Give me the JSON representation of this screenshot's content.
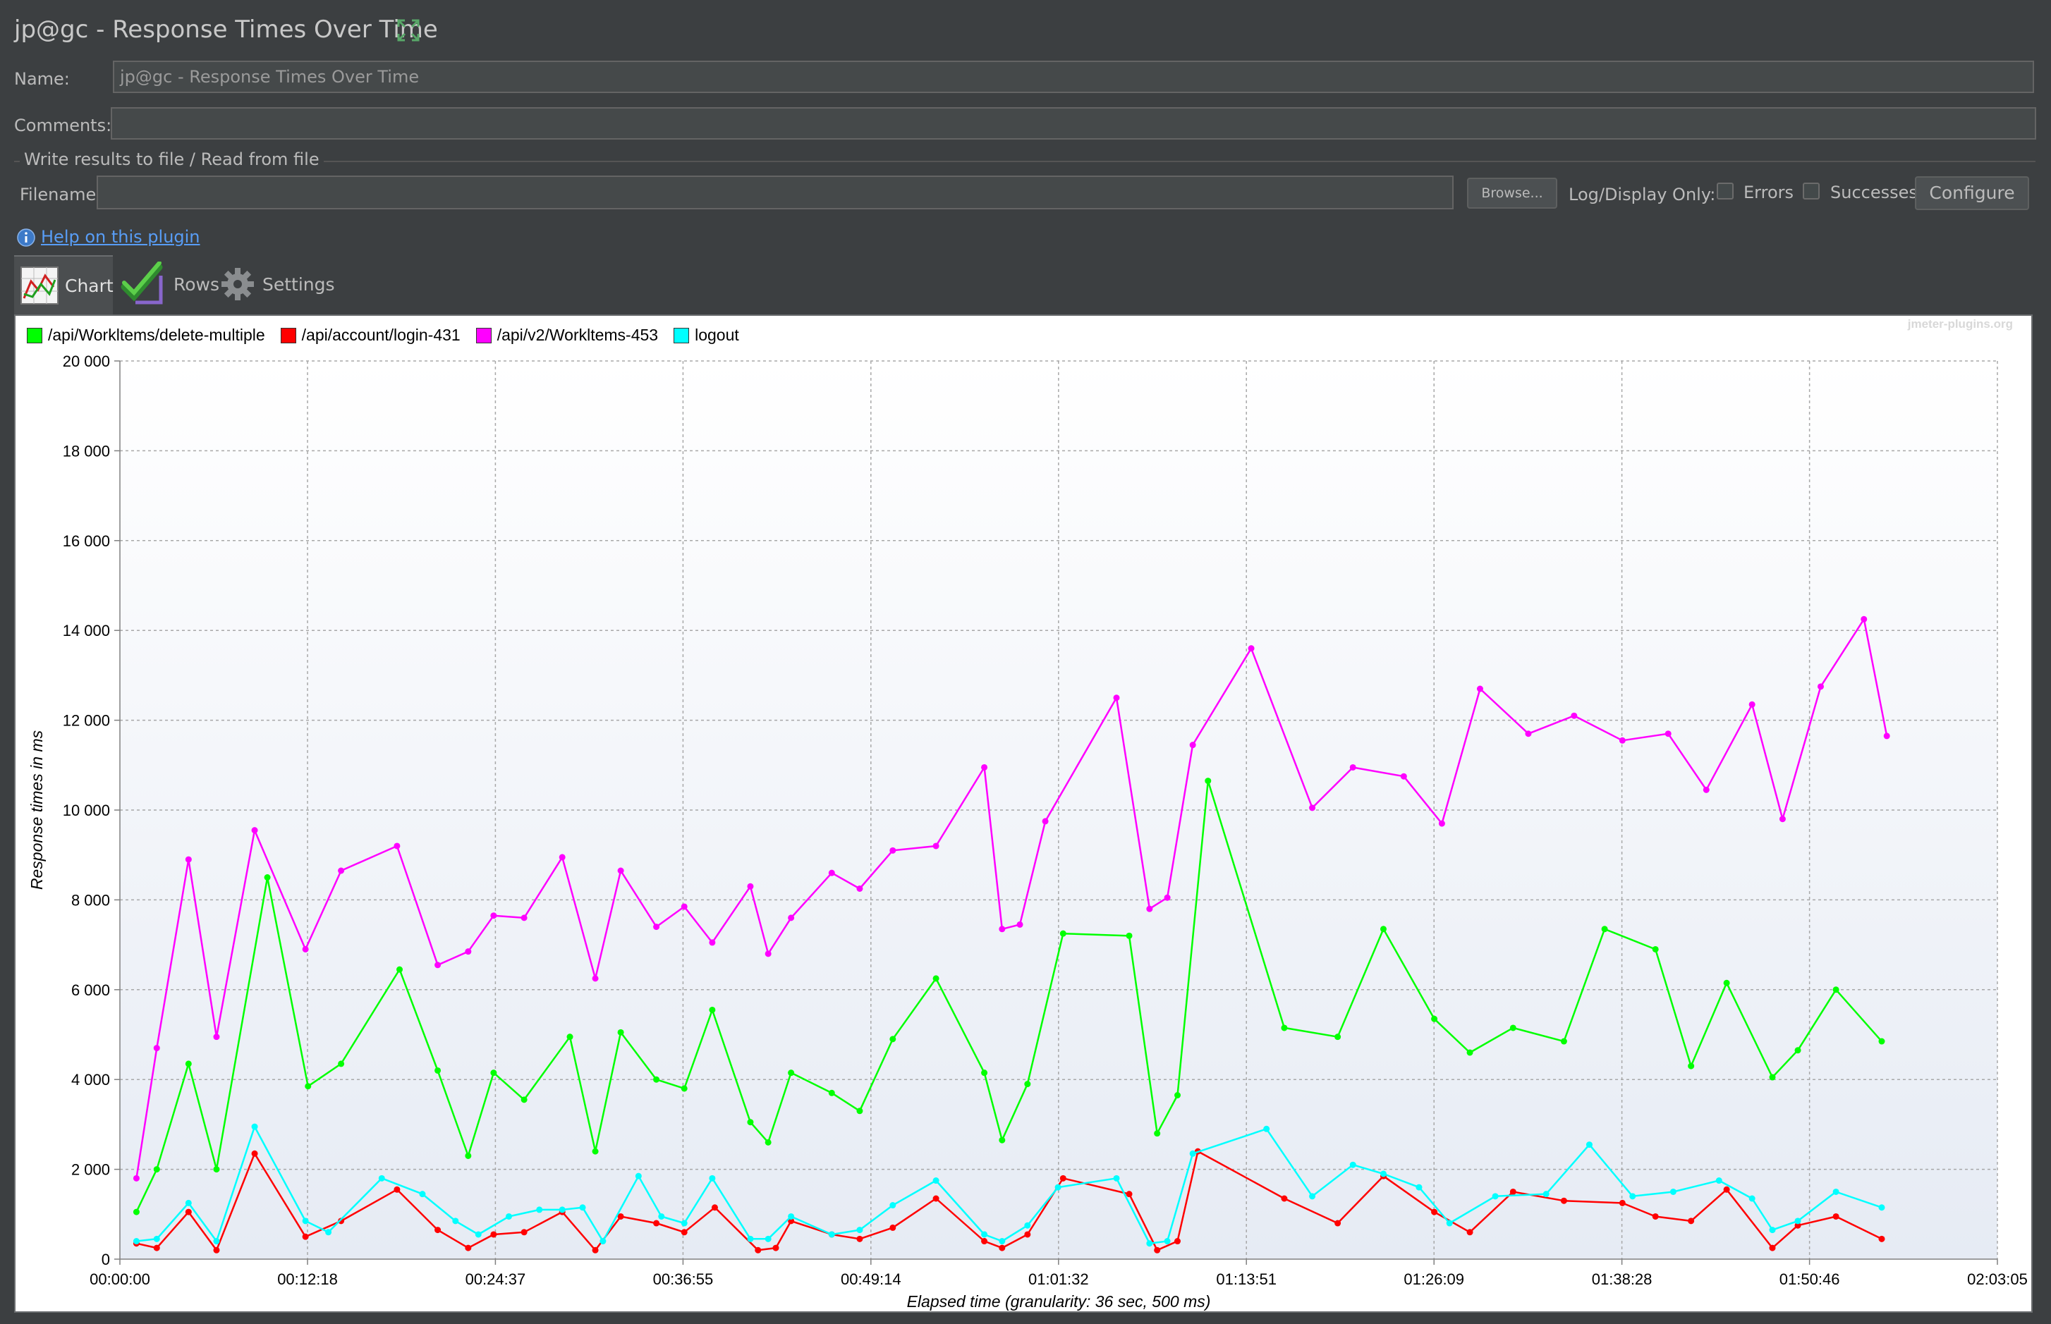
{
  "window": {
    "title": "jp@gc - Response Times Over Time"
  },
  "form": {
    "name_label": "Name:",
    "name_value": "jp@gc - Response Times Over Time",
    "comments_label": "Comments:",
    "comments_value": "",
    "group_title": "Write results to file / Read from file",
    "filename_label": "Filename",
    "filename_value": "",
    "browse_label": "Browse...",
    "log_display_label": "Log/Display Only:",
    "errors_label": "Errors",
    "successes_label": "Successes",
    "configure_label": "Configure"
  },
  "help": {
    "link_text": "Help on this plugin",
    "icon": "info-icon"
  },
  "tabs": [
    {
      "label": "Chart",
      "icon": "chart-icon",
      "active": true
    },
    {
      "label": "Rows",
      "icon": "checkmarks-icon",
      "active": false
    },
    {
      "label": "Settings",
      "icon": "gear-icon",
      "active": false
    }
  ],
  "chart_data": {
    "type": "line",
    "watermark": "jmeter-plugins.org",
    "xlabel": "Elapsed time (granularity: 36 sec, 500 ms)",
    "ylabel": "Response times in ms",
    "ylim": [
      0,
      20000
    ],
    "xlim": [
      "00:00:00",
      "02:03:05"
    ],
    "y_ticks": [
      "0",
      "2 000",
      "4 000",
      "6 000",
      "8 000",
      "10 000",
      "12 000",
      "14 000",
      "16 000",
      "18 000",
      "20 000"
    ],
    "x_ticks": [
      "00:00:00",
      "00:12:18",
      "00:24:37",
      "00:36:55",
      "00:49:14",
      "01:01:32",
      "01:13:51",
      "01:26:09",
      "01:38:28",
      "01:50:46",
      "02:03:05"
    ],
    "grid": true,
    "legend": "top-left",
    "series": [
      {
        "name": "/api/Workltems/delete-multiple",
        "color": "#00ff00",
        "points": [
          [
            "00:01:05",
            1050
          ],
          [
            "00:02:25",
            2000
          ],
          [
            "00:04:30",
            4350
          ],
          [
            "00:06:20",
            2000
          ],
          [
            "00:09:40",
            8500
          ],
          [
            "00:12:20",
            3850
          ],
          [
            "00:14:30",
            4350
          ],
          [
            "00:18:20",
            6450
          ],
          [
            "00:20:50",
            4200
          ],
          [
            "00:22:50",
            2300
          ],
          [
            "00:24:30",
            4150
          ],
          [
            "00:26:30",
            3550
          ],
          [
            "00:29:30",
            4950
          ],
          [
            "00:31:10",
            2400
          ],
          [
            "00:32:50",
            5050
          ],
          [
            "00:35:10",
            4000
          ],
          [
            "00:37:00",
            3800
          ],
          [
            "00:38:50",
            5550
          ],
          [
            "00:41:20",
            3050
          ],
          [
            "00:42:30",
            2600
          ],
          [
            "00:44:00",
            4150
          ],
          [
            "00:46:40",
            3700
          ],
          [
            "00:48:30",
            3300
          ],
          [
            "00:50:40",
            4900
          ],
          [
            "00:53:30",
            6250
          ],
          [
            "00:56:40",
            4150
          ],
          [
            "00:57:50",
            2650
          ],
          [
            "00:59:30",
            3900
          ],
          [
            "01:01:50",
            7250
          ],
          [
            "01:06:10",
            7200
          ],
          [
            "01:08:00",
            2800
          ],
          [
            "01:09:20",
            3650
          ],
          [
            "01:11:20",
            10650
          ],
          [
            "01:16:20",
            5150
          ],
          [
            "01:19:50",
            4950
          ],
          [
            "01:22:50",
            7350
          ],
          [
            "01:26:10",
            5350
          ],
          [
            "01:28:30",
            4600
          ],
          [
            "01:31:20",
            5150
          ],
          [
            "01:34:40",
            4850
          ],
          [
            "01:37:20",
            7350
          ],
          [
            "01:40:40",
            6900
          ],
          [
            "01:43:00",
            4300
          ],
          [
            "01:45:20",
            6150
          ],
          [
            "01:48:20",
            4050
          ],
          [
            "01:50:00",
            4650
          ],
          [
            "01:52:30",
            6000
          ],
          [
            "01:55:30",
            4850
          ]
        ]
      },
      {
        "name": "/api/account/login-431",
        "color": "#ff0000",
        "points": [
          [
            "00:01:05",
            350
          ],
          [
            "00:02:25",
            250
          ],
          [
            "00:04:30",
            1050
          ],
          [
            "00:06:20",
            200
          ],
          [
            "00:08:50",
            2350
          ],
          [
            "00:12:10",
            500
          ],
          [
            "00:14:30",
            850
          ],
          [
            "00:18:10",
            1550
          ],
          [
            "00:20:50",
            650
          ],
          [
            "00:22:50",
            250
          ],
          [
            "00:24:30",
            550
          ],
          [
            "00:26:30",
            600
          ],
          [
            "00:29:00",
            1050
          ],
          [
            "00:31:10",
            200
          ],
          [
            "00:32:50",
            950
          ],
          [
            "00:35:10",
            800
          ],
          [
            "00:37:00",
            600
          ],
          [
            "00:39:00",
            1150
          ],
          [
            "00:41:50",
            200
          ],
          [
            "00:43:00",
            250
          ],
          [
            "00:44:00",
            850
          ],
          [
            "00:46:40",
            550
          ],
          [
            "00:48:30",
            450
          ],
          [
            "00:50:40",
            700
          ],
          [
            "00:53:30",
            1350
          ],
          [
            "00:56:40",
            400
          ],
          [
            "00:57:50",
            250
          ],
          [
            "00:59:30",
            550
          ],
          [
            "01:01:50",
            1800
          ],
          [
            "01:06:10",
            1450
          ],
          [
            "01:08:00",
            200
          ],
          [
            "01:09:20",
            400
          ],
          [
            "01:10:40",
            2400
          ],
          [
            "01:16:20",
            1350
          ],
          [
            "01:19:50",
            800
          ],
          [
            "01:22:50",
            1850
          ],
          [
            "01:26:10",
            1050
          ],
          [
            "01:28:30",
            600
          ],
          [
            "01:31:20",
            1500
          ],
          [
            "01:34:40",
            1300
          ],
          [
            "01:38:30",
            1250
          ],
          [
            "01:40:40",
            950
          ],
          [
            "01:43:00",
            850
          ],
          [
            "01:45:20",
            1550
          ],
          [
            "01:48:20",
            250
          ],
          [
            "01:50:00",
            750
          ],
          [
            "01:52:30",
            950
          ],
          [
            "01:55:30",
            450
          ]
        ]
      },
      {
        "name": "/api/v2/Workltems-453",
        "color": "#ff00ff",
        "points": [
          [
            "00:01:05",
            1800
          ],
          [
            "00:02:25",
            4700
          ],
          [
            "00:04:30",
            8900
          ],
          [
            "00:06:20",
            4950
          ],
          [
            "00:08:50",
            9550
          ],
          [
            "00:12:10",
            6900
          ],
          [
            "00:14:30",
            8650
          ],
          [
            "00:18:10",
            9200
          ],
          [
            "00:20:50",
            6550
          ],
          [
            "00:22:50",
            6850
          ],
          [
            "00:24:30",
            7650
          ],
          [
            "00:26:30",
            7600
          ],
          [
            "00:29:00",
            8950
          ],
          [
            "00:31:10",
            6250
          ],
          [
            "00:32:50",
            8650
          ],
          [
            "00:35:10",
            7400
          ],
          [
            "00:37:00",
            7850
          ],
          [
            "00:38:50",
            7050
          ],
          [
            "00:41:20",
            8300
          ],
          [
            "00:42:30",
            6800
          ],
          [
            "00:44:00",
            7600
          ],
          [
            "00:46:40",
            8600
          ],
          [
            "00:48:30",
            8250
          ],
          [
            "00:50:40",
            9100
          ],
          [
            "00:53:30",
            9200
          ],
          [
            "00:56:40",
            10950
          ],
          [
            "00:57:50",
            7350
          ],
          [
            "00:59:00",
            7450
          ],
          [
            "01:00:40",
            9750
          ],
          [
            "01:05:20",
            12500
          ],
          [
            "01:07:30",
            7800
          ],
          [
            "01:08:40",
            8050
          ],
          [
            "01:10:20",
            11450
          ],
          [
            "01:14:10",
            13600
          ],
          [
            "01:18:10",
            10050
          ],
          [
            "01:20:50",
            10950
          ],
          [
            "01:24:10",
            10750
          ],
          [
            "01:26:40",
            9700
          ],
          [
            "01:29:10",
            12700
          ],
          [
            "01:32:20",
            11700
          ],
          [
            "01:35:20",
            12100
          ],
          [
            "01:38:30",
            11550
          ],
          [
            "01:41:30",
            11700
          ],
          [
            "01:44:00",
            10450
          ],
          [
            "01:47:00",
            12350
          ],
          [
            "01:49:00",
            9800
          ],
          [
            "01:51:30",
            12750
          ],
          [
            "01:54:20",
            14250
          ],
          [
            "01:55:50",
            11650
          ]
        ]
      },
      {
        "name": "logout",
        "color": "#00ffff",
        "points": [
          [
            "00:01:05",
            400
          ],
          [
            "00:02:25",
            450
          ],
          [
            "00:04:30",
            1250
          ],
          [
            "00:06:20",
            400
          ],
          [
            "00:08:50",
            2950
          ],
          [
            "00:12:10",
            850
          ],
          [
            "00:13:40",
            600
          ],
          [
            "00:17:10",
            1800
          ],
          [
            "00:19:50",
            1450
          ],
          [
            "00:22:00",
            850
          ],
          [
            "00:23:30",
            550
          ],
          [
            "00:25:30",
            950
          ],
          [
            "00:27:30",
            1100
          ],
          [
            "00:29:00",
            1100
          ],
          [
            "00:30:20",
            1150
          ],
          [
            "00:31:40",
            400
          ],
          [
            "00:34:00",
            1850
          ],
          [
            "00:35:30",
            950
          ],
          [
            "00:37:00",
            800
          ],
          [
            "00:38:50",
            1800
          ],
          [
            "00:41:20",
            450
          ],
          [
            "00:42:30",
            450
          ],
          [
            "00:44:00",
            950
          ],
          [
            "00:46:40",
            550
          ],
          [
            "00:48:30",
            650
          ],
          [
            "00:50:40",
            1200
          ],
          [
            "00:53:30",
            1750
          ],
          [
            "00:56:40",
            550
          ],
          [
            "00:57:50",
            400
          ],
          [
            "00:59:30",
            750
          ],
          [
            "01:01:30",
            1600
          ],
          [
            "01:05:20",
            1800
          ],
          [
            "01:07:30",
            350
          ],
          [
            "01:08:40",
            400
          ],
          [
            "01:10:20",
            2350
          ],
          [
            "01:15:10",
            2900
          ],
          [
            "01:18:10",
            1400
          ],
          [
            "01:20:50",
            2100
          ],
          [
            "01:22:50",
            1900
          ],
          [
            "01:25:10",
            1600
          ],
          [
            "01:27:10",
            800
          ],
          [
            "01:30:10",
            1400
          ],
          [
            "01:33:30",
            1450
          ],
          [
            "01:36:20",
            2550
          ],
          [
            "01:39:10",
            1400
          ],
          [
            "01:41:50",
            1500
          ],
          [
            "01:44:50",
            1750
          ],
          [
            "01:47:00",
            1350
          ],
          [
            "01:48:20",
            650
          ],
          [
            "01:50:00",
            850
          ],
          [
            "01:52:30",
            1500
          ],
          [
            "01:55:30",
            1150
          ]
        ]
      }
    ]
  }
}
